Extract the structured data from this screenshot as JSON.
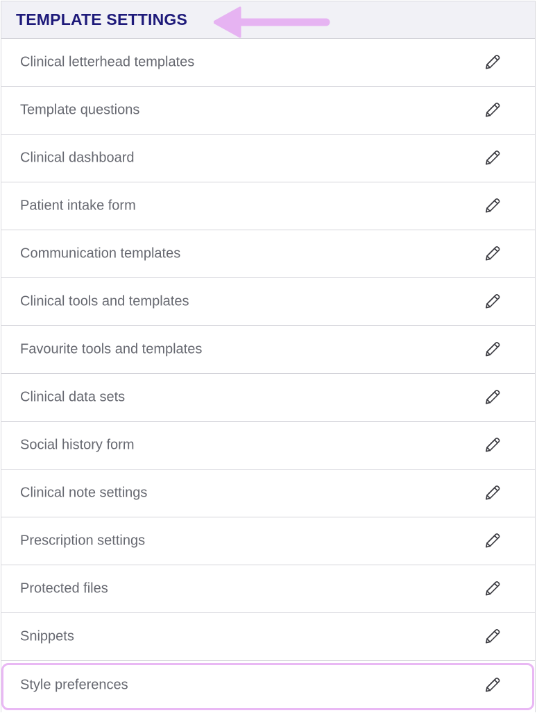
{
  "header": {
    "title": "TEMPLATE SETTINGS",
    "arrow_color": "#e6b3f2",
    "title_color": "#1e1a7a"
  },
  "highlight_color": "#e9b8f4",
  "items": [
    {
      "label": "Clinical letterhead templates",
      "icon": "pencil-edit-icon"
    },
    {
      "label": "Template questions",
      "icon": "pencil-edit-icon"
    },
    {
      "label": "Clinical dashboard",
      "icon": "pencil-edit-icon"
    },
    {
      "label": "Patient intake form",
      "icon": "pencil-edit-icon"
    },
    {
      "label": "Communication templates",
      "icon": "pencil-edit-icon"
    },
    {
      "label": "Clinical tools and templates",
      "icon": "pencil-edit-icon"
    },
    {
      "label": "Favourite tools and templates",
      "icon": "pencil-edit-icon"
    },
    {
      "label": "Clinical data sets",
      "icon": "pencil-edit-icon"
    },
    {
      "label": "Social history form",
      "icon": "pencil-edit-icon"
    },
    {
      "label": "Clinical note settings",
      "icon": "pencil-edit-icon"
    },
    {
      "label": "Prescription settings",
      "icon": "pencil-edit-icon"
    },
    {
      "label": "Protected files",
      "icon": "pencil-edit-icon"
    },
    {
      "label": "Snippets",
      "icon": "pencil-edit-icon"
    },
    {
      "label": "Style preferences",
      "icon": "pencil-edit-icon",
      "highlighted": true
    }
  ]
}
